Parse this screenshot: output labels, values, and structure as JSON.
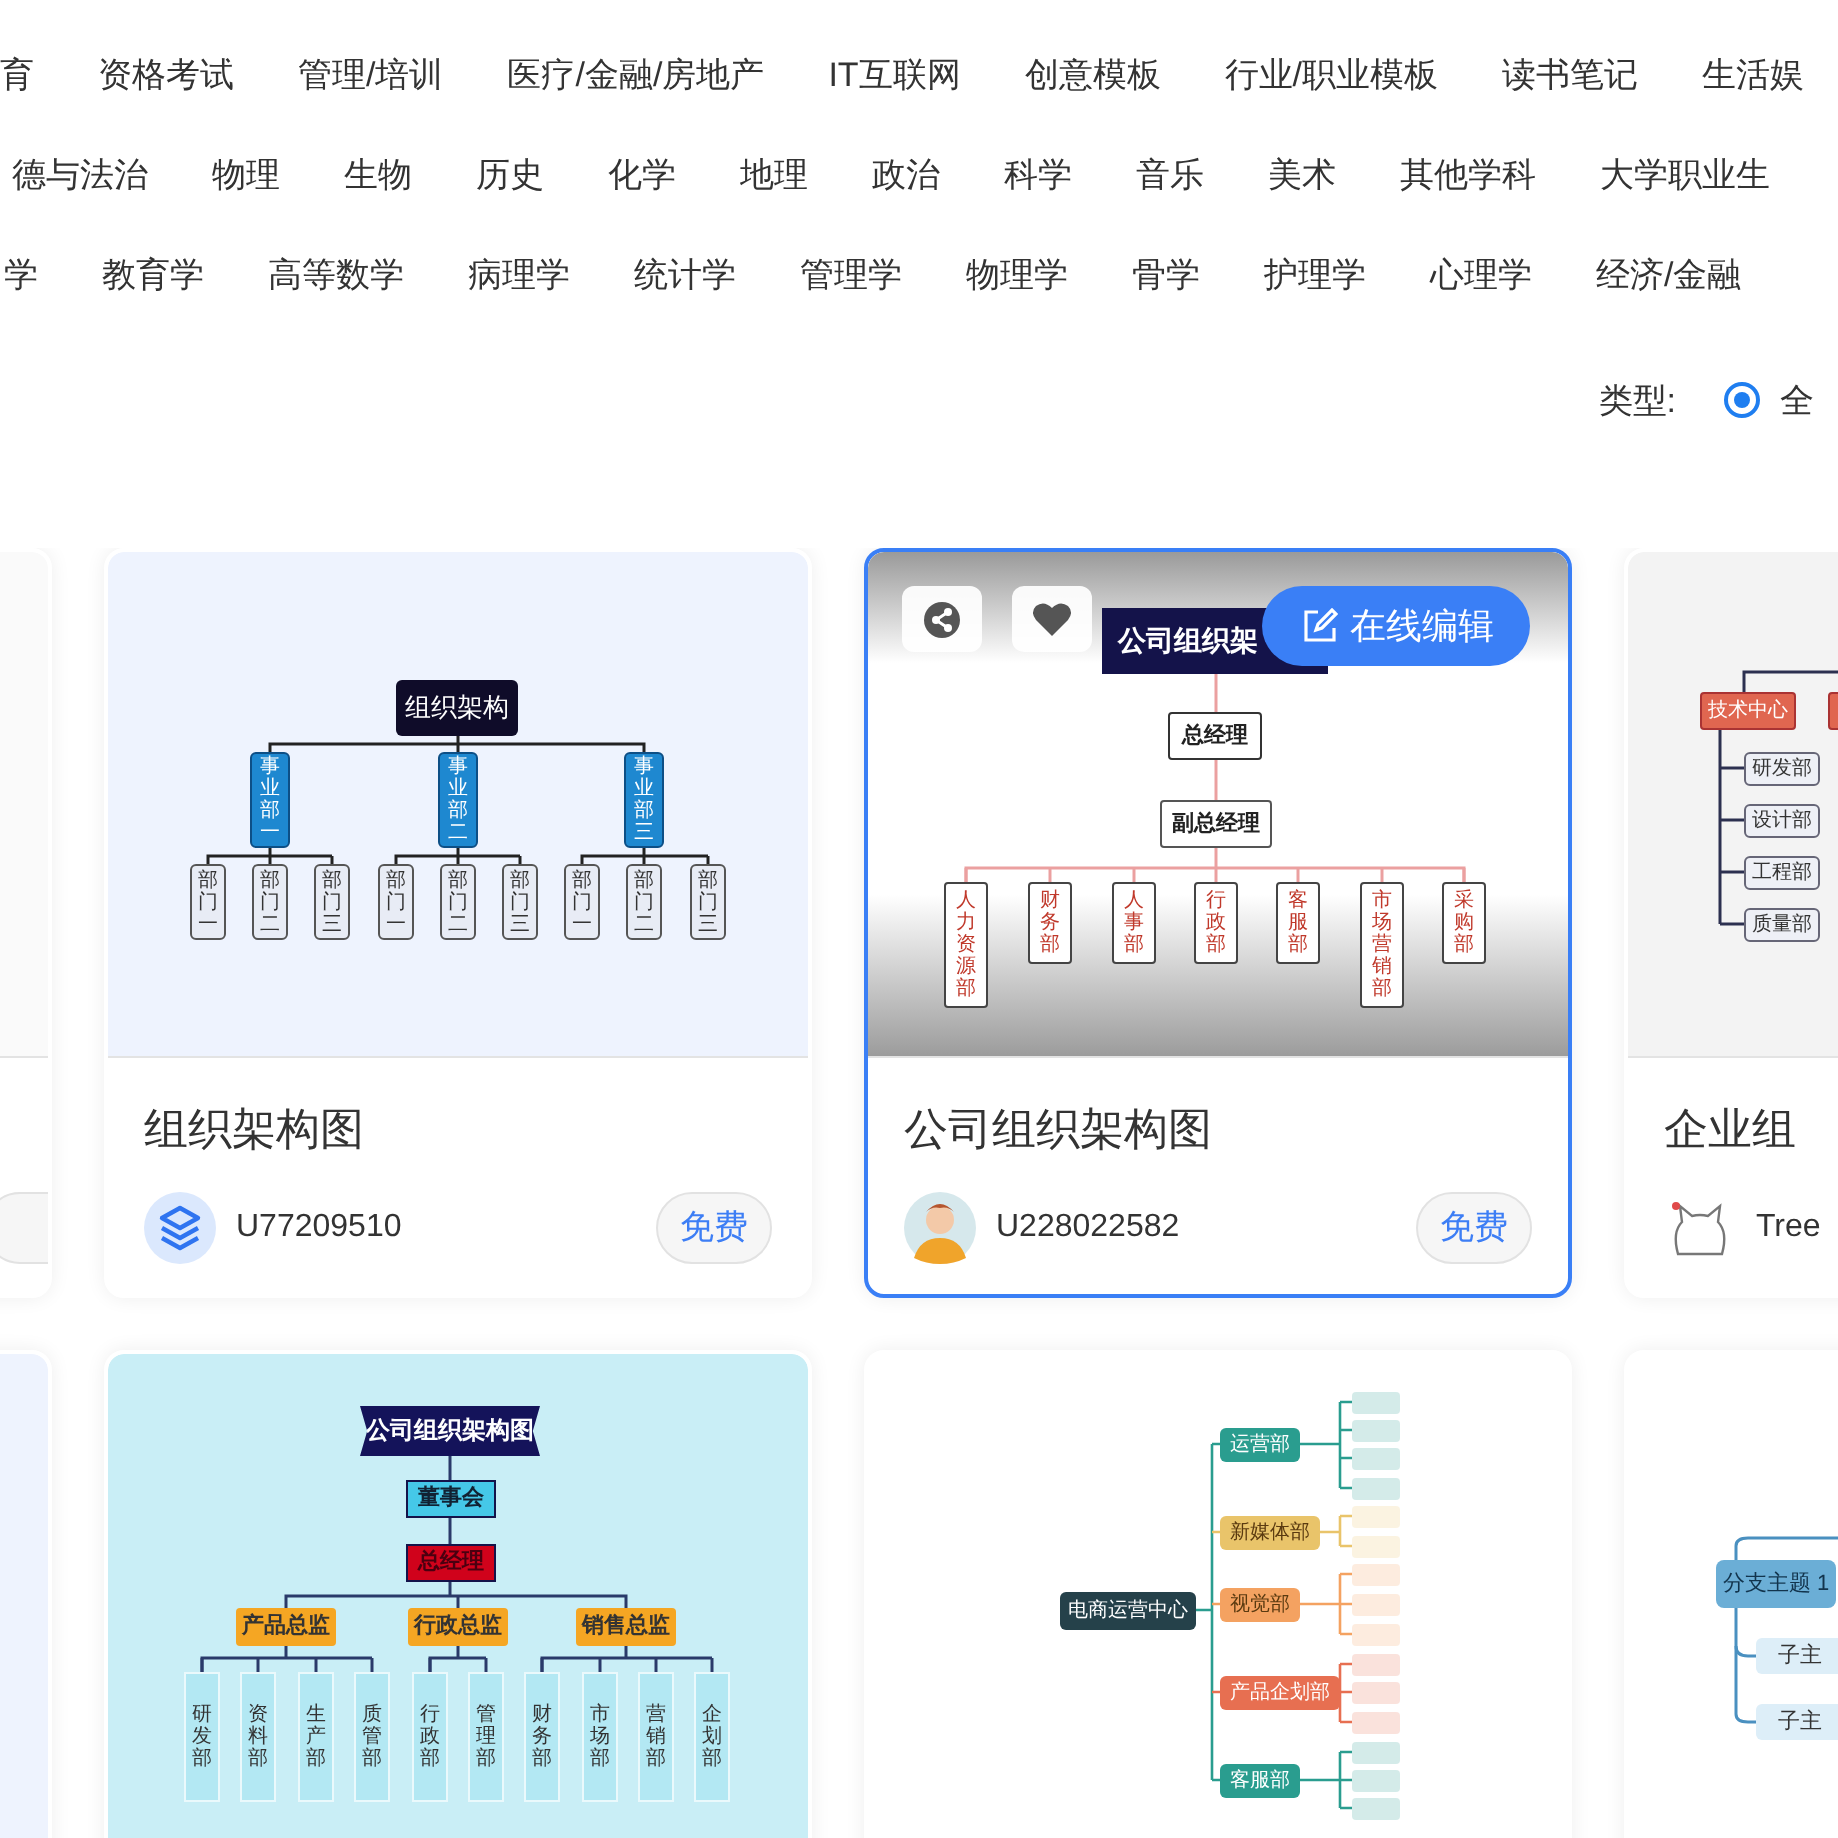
{
  "category_rows": [
    [
      "育",
      "资格考试",
      "管理/培训",
      "医疗/金融/房地产",
      "IT互联网",
      "创意模板",
      "行业/职业模板",
      "读书笔记",
      "生活娱"
    ],
    [
      "德与法治",
      "物理",
      "生物",
      "历史",
      "化学",
      "地理",
      "政治",
      "科学",
      "音乐",
      "美术",
      "其他学科",
      "大学职业生"
    ],
    [
      "学",
      "教育学",
      "高等数学",
      "病理学",
      "统计学",
      "管理学",
      "物理学",
      "骨学",
      "护理学",
      "心理学",
      "经济/金融"
    ]
  ],
  "filter": {
    "label": "类型:",
    "options": [
      {
        "label": "全",
        "selected": true
      }
    ]
  },
  "card_rows": [
    {
      "cards": [
        {
          "kind": "clipped",
          "hovered": false,
          "thumb": {
            "kind": "blank"
          }
        },
        {
          "kind": "full",
          "hovered": false,
          "thumb": {
            "kind": "org3",
            "nodes": [
              "组织架构",
              "事业部一",
              "事业部二",
              "事业部三",
              "部门一",
              "部门二",
              "部门三",
              "部门一",
              "部门二",
              "部门三",
              "部门一",
              "部门二",
              "部门三"
            ]
          },
          "title": "组织架构图",
          "avatar": {
            "kind": "logo"
          },
          "user": "U77209510",
          "price": "免费"
        },
        {
          "kind": "full",
          "hovered": true,
          "hover_action": "在线编辑",
          "thumb": {
            "kind": "org7",
            "nodes": [
              "公司组织架",
              "总经理",
              "副总经理",
              "人力资源部",
              "财务部",
              "人事部",
              "行政部",
              "客服部",
              "市场营销部",
              "采购部"
            ]
          },
          "title": "公司组织架构图",
          "avatar": {
            "kind": "person"
          },
          "user": "U228022582",
          "price": "免费"
        },
        {
          "kind": "full",
          "hovered": false,
          "thumb": {
            "kind": "tree-left",
            "nodes": [
              "技术中心",
              "研发部",
              "设计部",
              "工程部",
              "质量部"
            ]
          },
          "title": "企业组",
          "avatar": {
            "kind": "cat"
          },
          "user": "Tree"
        }
      ]
    },
    {
      "cards": [
        {
          "kind": "clipped",
          "hovered": false,
          "thumb": {
            "kind": "tinted"
          }
        },
        {
          "kind": "full",
          "hovered": false,
          "thumb": {
            "kind": "org-banner",
            "nodes": [
              "公司组织架构图",
              "董事会",
              "总经理",
              "产品总监",
              "行政总监",
              "销售总监",
              "研发部",
              "资料部",
              "生产部",
              "质管部",
              "行政部",
              "管理部",
              "财务部",
              "市场部",
              "营销部",
              "企划部"
            ]
          }
        },
        {
          "kind": "full",
          "hovered": false,
          "thumb": {
            "kind": "mindmap",
            "root": "电商运营中心",
            "branches": [
              {
                "label": "运营部",
                "color": "#2a9d8f"
              },
              {
                "label": "新媒体部",
                "color": "#e9c46a"
              },
              {
                "label": "视觉部",
                "color": "#f4a261"
              },
              {
                "label": "产品企划部",
                "color": "#e76f51"
              },
              {
                "label": "客服部",
                "color": "#2a9d8f"
              }
            ]
          }
        },
        {
          "kind": "full",
          "hovered": false,
          "thumb": {
            "kind": "branch",
            "nodes": [
              "分支主题 1",
              "子主",
              "子主"
            ]
          }
        }
      ]
    }
  ]
}
